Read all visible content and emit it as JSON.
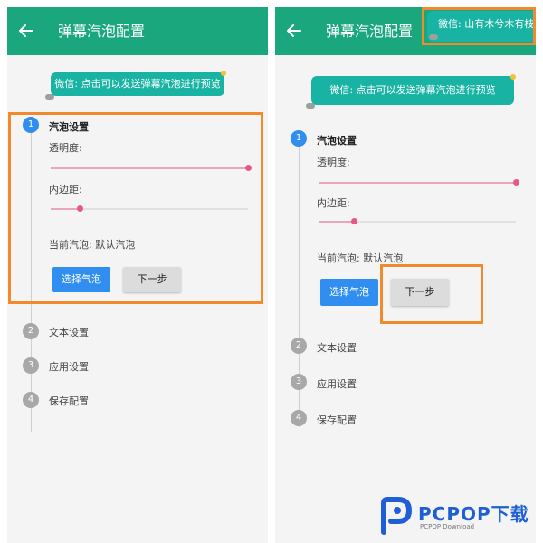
{
  "left_screen": {
    "appbar_title": "弹幕汽泡配置",
    "bubble_text": "微信: 点击可以发送弹幕汽泡进行预览",
    "steps": [
      {
        "num": "1",
        "title": "汽泡设置"
      },
      {
        "num": "2",
        "title": "文本设置"
      },
      {
        "num": "3",
        "title": "应用设置"
      },
      {
        "num": "4",
        "title": "保存配置"
      }
    ],
    "opacity_label": "透明度:",
    "padding_label": "内边距:",
    "opacity_level": 1.0,
    "padding_level": 0.15,
    "current_bubble": "当前汽泡: 默认汽泡",
    "select_button": "选择气泡",
    "next_button": "下一步"
  },
  "right_screen": {
    "appbar_title": "弹幕汽泡配置",
    "toast_text": "微信: 山有木兮木有枝",
    "bubble_text": "微信: 点击可以发送弹幕汽泡进行预览",
    "steps": [
      {
        "num": "1",
        "title": "汽泡设置"
      },
      {
        "num": "2",
        "title": "文本设置"
      },
      {
        "num": "3",
        "title": "应用设置"
      },
      {
        "num": "4",
        "title": "保存配置"
      }
    ],
    "opacity_label": "透明度:",
    "padding_label": "内边距:",
    "opacity_level": 1.0,
    "padding_level": 0.18,
    "current_bubble": "当前汽泡: 默认汽泡",
    "select_button": "选择气泡",
    "next_button": "下一步"
  },
  "watermark": {
    "brand": "PCPOP下载",
    "sub": "PCPOP Download"
  },
  "colors": {
    "appbar": "#1aa77e",
    "bubble": "#18b3a3",
    "primary": "#2f8ef0",
    "highlight": "#f08a2c",
    "slider": "#e8578a"
  }
}
